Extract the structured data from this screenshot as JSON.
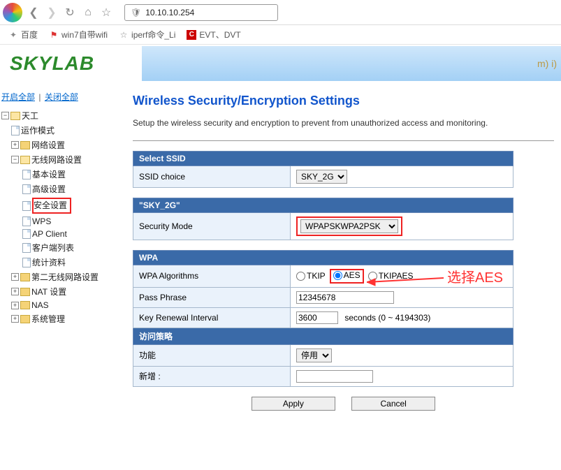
{
  "browser": {
    "url": "10.10.10.254"
  },
  "bookmarks": {
    "b1": "百度",
    "b2": "win7自带wifi",
    "b3": "iperf命令_Li",
    "b4": "EVT、DVT"
  },
  "logo": "SKYLAB",
  "banner_item": "m) i)",
  "tree_controls": {
    "open_all": "开启全部",
    "close_all": "关闭全部"
  },
  "tree": {
    "root": "天工",
    "op_mode": "运作模式",
    "net_set": "网络设置",
    "wlan_set": "无线网路设置",
    "basic": "基本设置",
    "adv": "高级设置",
    "sec": "安全设置",
    "wps": "WPS",
    "apclient": "AP Client",
    "client_list": "客户端列表",
    "stats": "统计资料",
    "wlan2": "第二无线网路设置",
    "nat": "NAT 设置",
    "nas": "NAS",
    "sys": "系统管理"
  },
  "page": {
    "title": "Wireless Security/Encryption Settings",
    "subtitle": "Setup the wireless security and encryption to prevent from unauthorized access and monitoring."
  },
  "tables": {
    "select_ssid": "Select SSID",
    "ssid_choice": "SSID choice",
    "ssid_value": "SKY_2G",
    "sky_header": "\"SKY_2G\"",
    "security_mode": "Security Mode",
    "security_value": "WPAPSKWPA2PSK",
    "wpa": "WPA",
    "wpa_alg": "WPA Algorithms",
    "alg_tkip": "TKIP",
    "alg_aes": "AES",
    "alg_tkipaes": "TKIPAES",
    "pass": "Pass Phrase",
    "pass_val": "12345678",
    "key_renew": "Key Renewal Interval",
    "key_val": "3600",
    "key_suffix": "seconds   (0 ~ 4194303)",
    "access_policy": "访问策略",
    "func": "功能",
    "func_val": "停用",
    "add": "新增 :"
  },
  "buttons": {
    "apply": "Apply",
    "cancel": "Cancel"
  },
  "annotation": "选择AES"
}
